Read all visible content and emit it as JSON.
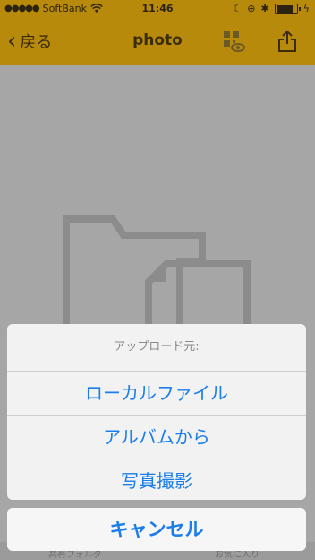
{
  "status_bar": {
    "carrier": "SoftBank",
    "time": "11:46",
    "signal_icon": "signal-dots-icon",
    "wifi_icon": "wifi-icon"
  },
  "nav": {
    "back_label": "戻る",
    "title": "photo"
  },
  "action_sheet": {
    "title": "アップロード元:",
    "options": [
      "ローカルファイル",
      "アルバムから",
      "写真撮影"
    ],
    "cancel_label": "キャンセル"
  },
  "bottom_tabs": [
    "共有フォルダ",
    "お気に入り"
  ],
  "colors": {
    "nav_bg": "#b78a0b",
    "action_text": "#1a7dea",
    "dim_bg": "#a6a6a6"
  }
}
